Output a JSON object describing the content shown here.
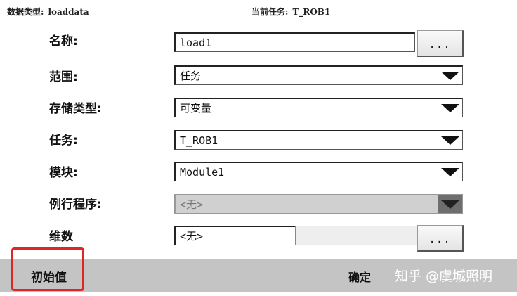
{
  "header": {
    "datatype_label": "数据类型:",
    "datatype_value": "loaddata",
    "task_label": "当前任务:",
    "task_value": "T_ROB1"
  },
  "form": {
    "name_label": "名称:",
    "name_value": "load1",
    "browse_label": "...",
    "scope_label": "范围:",
    "scope_value": "任务",
    "storage_label": "存储类型:",
    "storage_value": "可变量",
    "task_label": "任务:",
    "task_value": "T_ROB1",
    "module_label": "模块:",
    "module_value": "Module1",
    "routine_label": "例行程序:",
    "routine_value": "<无>",
    "dimension_label": "维数",
    "dimension_value": "<无>",
    "dimension_browse_label": "..."
  },
  "footer": {
    "initial_value_label": "初始值",
    "ok_label": "确定",
    "watermark": "知乎 @虞城照明"
  },
  "colors": {
    "highlight": "#e12525",
    "footer_bg": "#c4c4c4"
  }
}
